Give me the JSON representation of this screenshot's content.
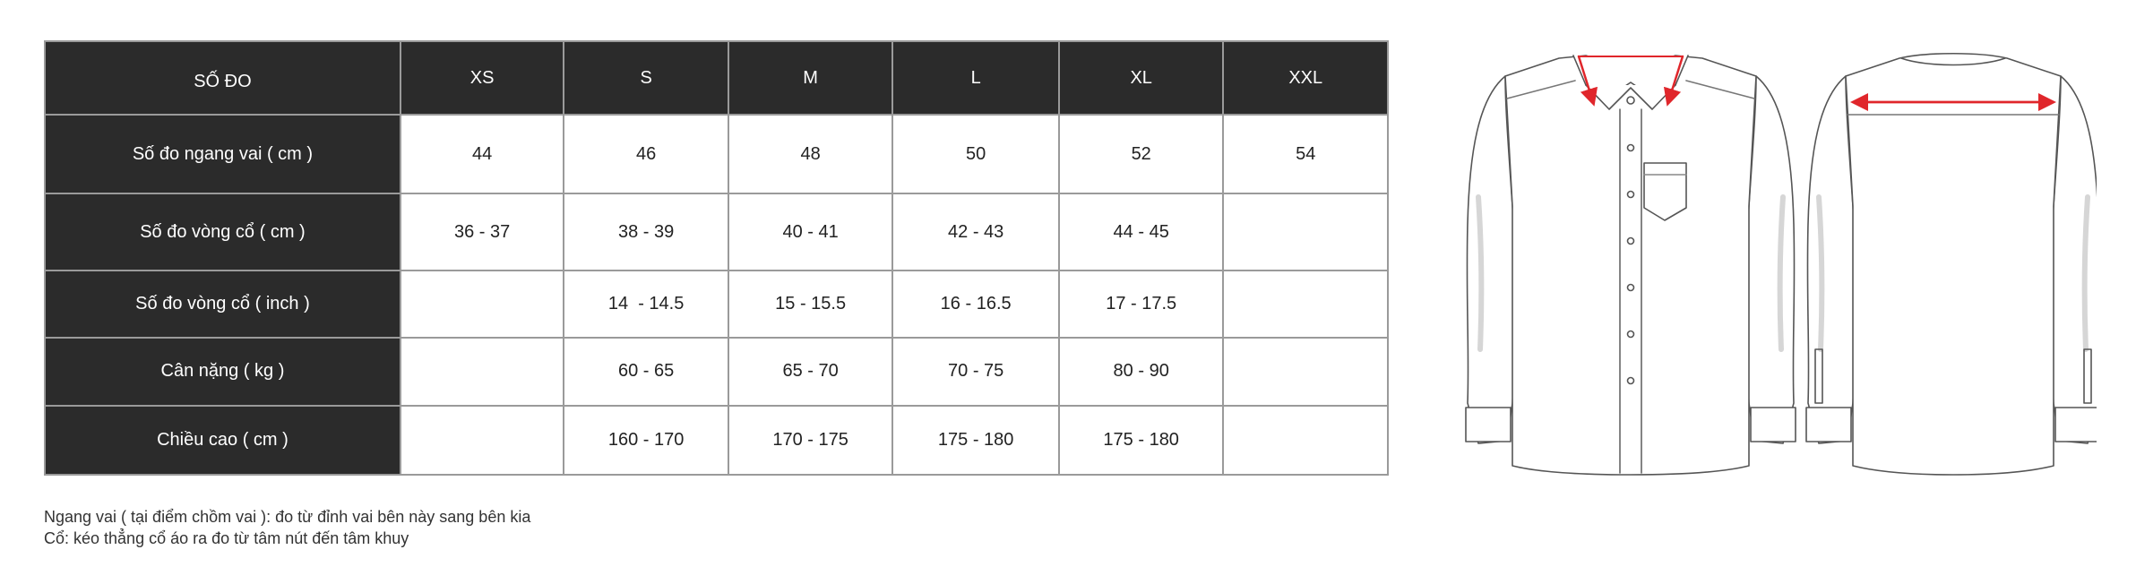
{
  "table": {
    "header": [
      "SỐ ĐO",
      "XS",
      "S",
      "M",
      "L",
      "XL",
      "XXL"
    ],
    "rows": [
      {
        "label": "Số đo ngang vai ( cm )",
        "cells": [
          "44",
          "46",
          "48",
          "50",
          "52",
          "54"
        ]
      },
      {
        "label": "Số đo vòng cổ ( cm )",
        "cells": [
          "36 - 37",
          "38 - 39",
          "40 - 41",
          "42 - 43",
          "44 - 45",
          ""
        ]
      },
      {
        "label": "Số đo vòng cổ ( inch )",
        "cells": [
          "",
          "14  - 14.5",
          "15 - 15.5",
          "16 - 16.5",
          "17 - 17.5",
          ""
        ]
      },
      {
        "label": "Cân nặng ( kg )",
        "cells": [
          "",
          "60 - 65",
          "65 - 70",
          "70 - 75",
          "80 - 90",
          ""
        ]
      },
      {
        "label": "Chiều cao ( cm )",
        "cells": [
          "",
          "160 - 170",
          "170 - 175",
          "175 - 180",
          "175 - 180",
          ""
        ]
      }
    ]
  },
  "notes": [
    "Ngang vai ( tại điểm chồm vai ): đo từ đỉnh vai bên này sang bên kia",
    "Cổ: kéo thẳng cổ áo ra đo từ tâm nút đến tâm khuy"
  ],
  "illustration": {
    "front_icon": "shirt-front-icon",
    "back_icon": "shirt-back-icon",
    "arrow_color": "#e0262b",
    "header_color": "#2b2b2b"
  }
}
